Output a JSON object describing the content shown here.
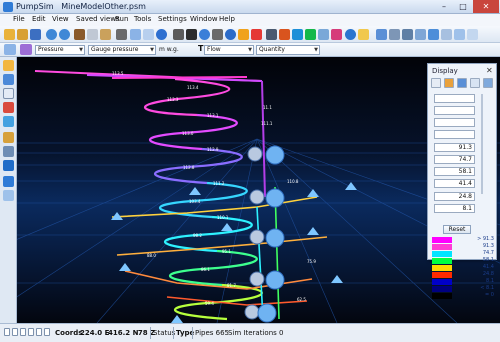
{
  "window": {
    "app_name": "PumpSim",
    "document": "MineModelOther.psm",
    "minimize_glyph": "–",
    "maximize_glyph": "□",
    "close_glyph": "✕"
  },
  "menu": [
    "File",
    "Edit",
    "View",
    "Saved views",
    "Run",
    "Tools",
    "Settings",
    "Window",
    "Help"
  ],
  "toolbar2": {
    "measure_select": "Pressure",
    "type_select": "Gauge pressure",
    "unit": "m w.g.",
    "text_tool": "T",
    "flow_select": "Flow",
    "quantity_select": "Quantity"
  },
  "display_panel": {
    "title": "Display",
    "close_glyph": "✕",
    "values": [
      "91.3",
      "74.7",
      "58.1",
      "41.4",
      "24.8",
      "8.1"
    ],
    "reset_label": "Reset",
    "legend": [
      {
        "label": "> 91.3",
        "color": "#ff00ff"
      },
      {
        "label": "91.3",
        "color": "#ff3bd6"
      },
      {
        "label": "74.7",
        "color": "#00e5ff"
      },
      {
        "label": "58.1",
        "color": "#00ff40"
      },
      {
        "label": "41.4",
        "color": "#ffd800"
      },
      {
        "label": "24.8",
        "color": "#ff2a00"
      },
      {
        "label": "8.1",
        "color": "#0000c8"
      },
      {
        "label": "< 8.1",
        "color": "#000080"
      },
      {
        "label": "= 0",
        "color": "#000000"
      }
    ]
  },
  "status": {
    "coords_label": "Coords",
    "x": "224.0 E",
    "y": "416.2 N",
    "z": "-78 Z",
    "status_label": "Status",
    "type_label": "Type",
    "pipes": "Pipes 665",
    "sim": "Sim Iterations 0"
  },
  "viewport_labels": [
    "113.5",
    "113.4",
    "113.3",
    "113.1",
    "113.0",
    "112.9",
    "112.8",
    "111.1",
    "111.2",
    "103.4",
    "110.8",
    "110.1",
    "98.2",
    "95.1",
    "88.0",
    "86.1",
    "81.7",
    "75.9",
    "59.4",
    "62.5",
    "11.1"
  ],
  "colors": {
    "accent": "#2f7bd6",
    "viewport_bg": "#0a2a5e",
    "close_red": "#c9463d"
  }
}
